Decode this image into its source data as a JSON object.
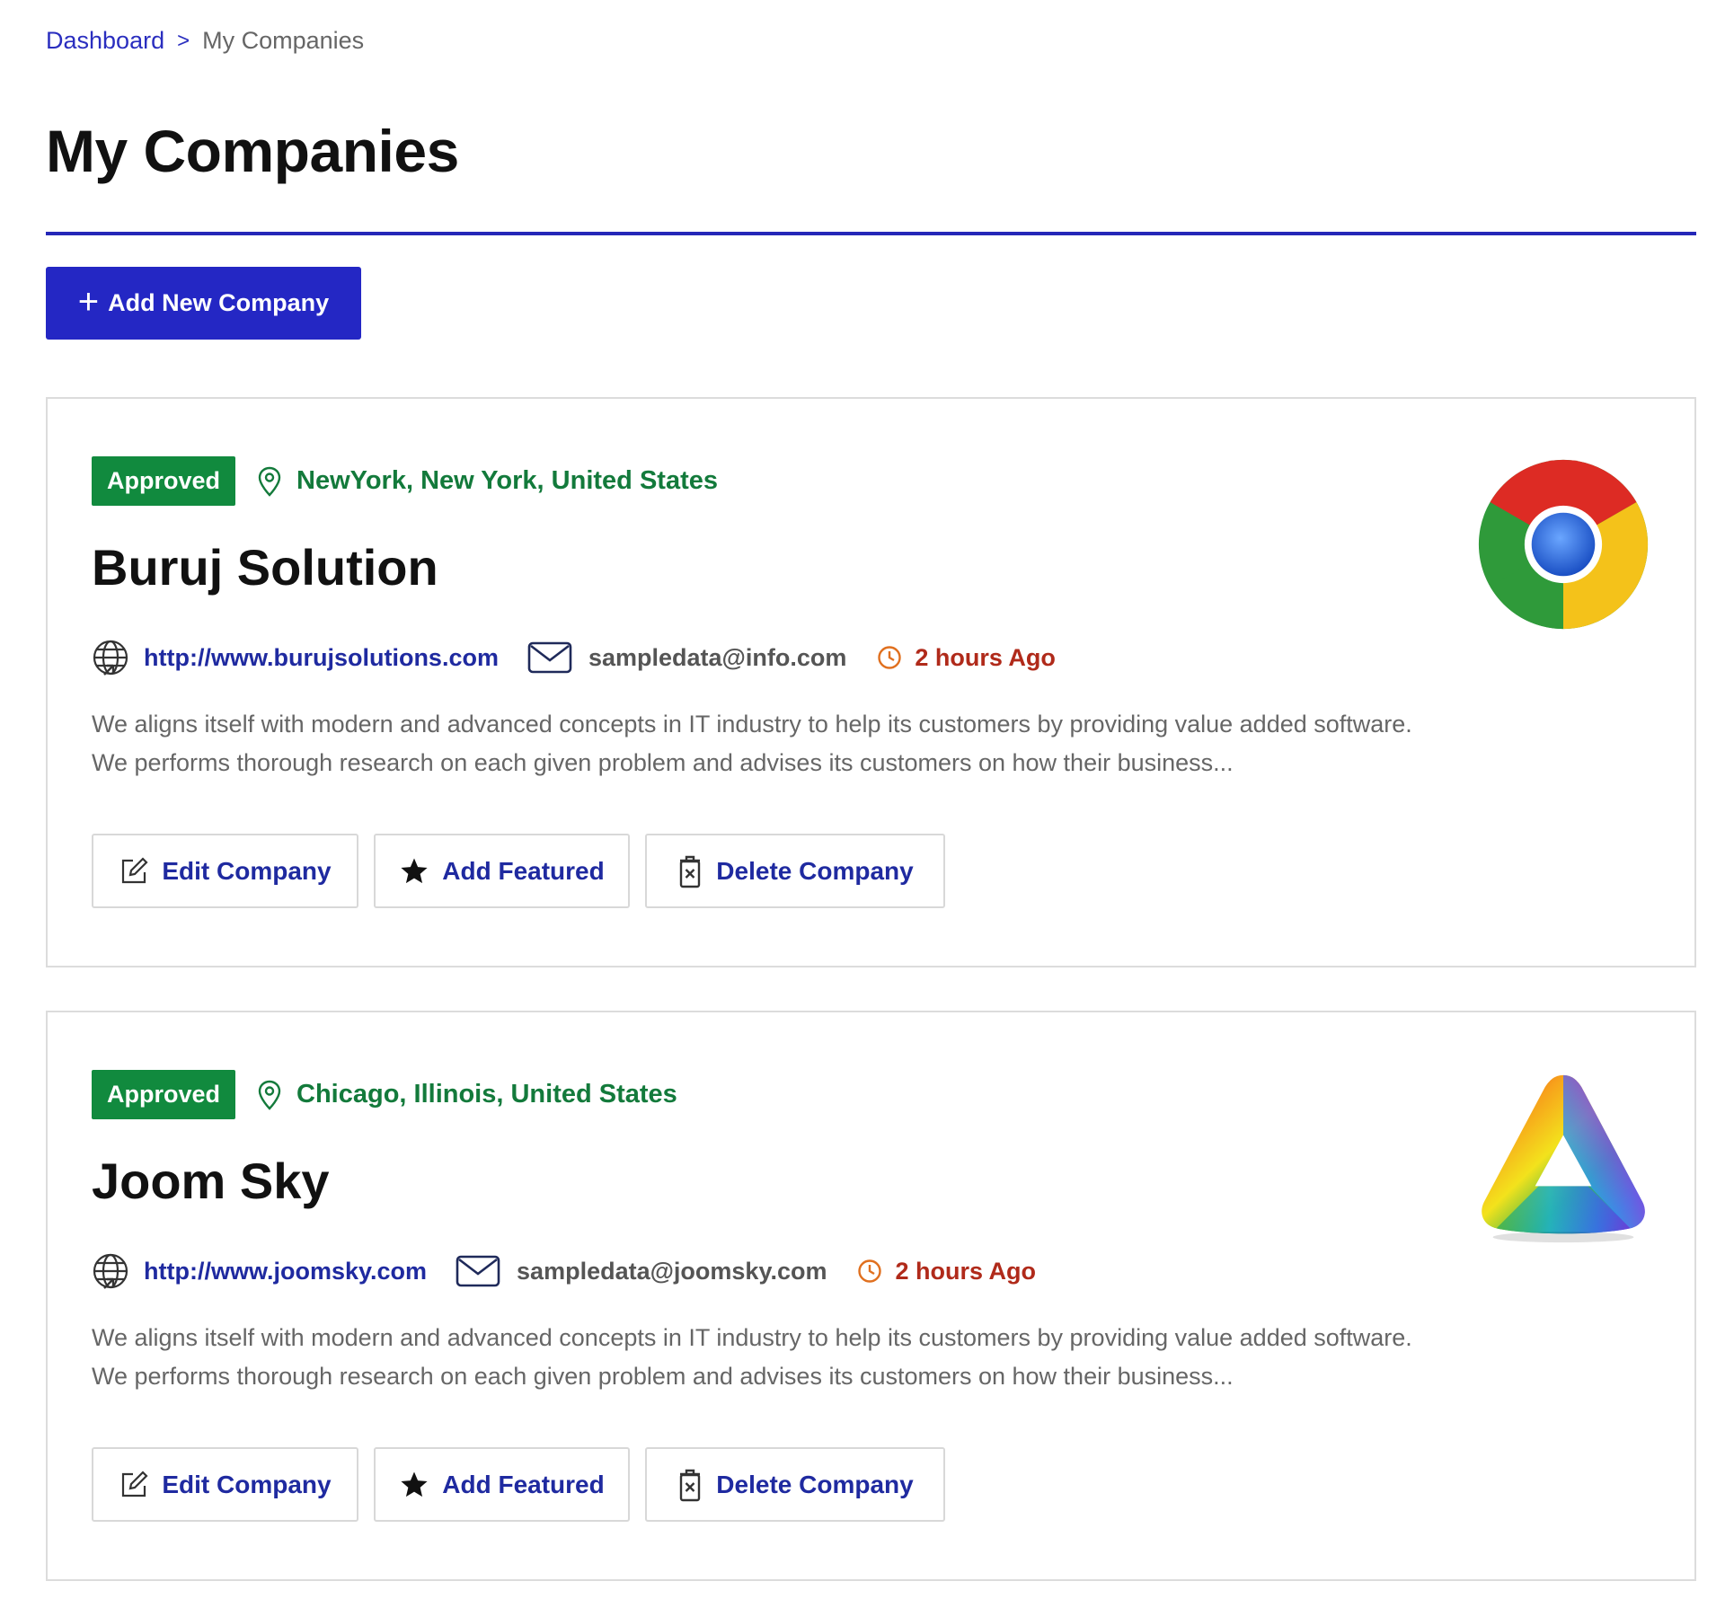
{
  "breadcrumb": {
    "home": "Dashboard",
    "separator": ">",
    "current": "My Companies"
  },
  "page": {
    "title": "My Companies",
    "add_button_label": "Add New Company",
    "accent_color": "#2427c4"
  },
  "companies": [
    {
      "status": "Approved",
      "location": "NewYork, New York, United States",
      "name": "Buruj Solution",
      "website": "http://www.burujsolutions.com",
      "email": "sampledata@info.com",
      "posted": "2 hours Ago",
      "description": "We aligns itself with modern and advanced concepts in IT industry to help its customers by providing value added software. We performs thorough research on each given problem and advises its customers on how their business...",
      "logo_icon": "chrome-logo-icon",
      "actions": {
        "edit": "Edit Company",
        "featured": "Add Featured",
        "delete": "Delete Company"
      }
    },
    {
      "status": "Approved",
      "location": "Chicago, Illinois, United States",
      "name": "Joom Sky",
      "website": "http://www.joomsky.com",
      "email": "sampledata@joomsky.com",
      "posted": "2 hours Ago",
      "description": "We aligns itself with modern and advanced concepts in IT industry to help its customers by providing value added software. We performs thorough research on each given problem and advises its customers on how their business...",
      "logo_icon": "rainbow-triangle-logo-icon",
      "actions": {
        "edit": "Edit Company",
        "featured": "Add Featured",
        "delete": "Delete Company"
      }
    }
  ],
  "colors": {
    "approved_badge": "#118a3e",
    "location_text": "#137a3b",
    "link_text": "#1f2aa0",
    "time_text": "#b02a1a",
    "clock_icon": "#e0701f"
  }
}
